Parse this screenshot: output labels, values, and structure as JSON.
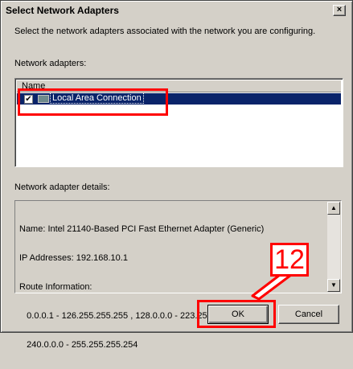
{
  "window": {
    "title": "Select Network Adapters",
    "close_glyph": "×"
  },
  "description": "Select the network adapters associated with the network you are configuring.",
  "adapters": {
    "label": "Network adapters:",
    "column_header": "Name",
    "items": [
      {
        "checked": true,
        "label": "Local Area Connection",
        "icon": "network-adapter-icon"
      }
    ]
  },
  "details": {
    "label": "Network adapter details:",
    "lines": [
      "Name: Intel 21140-Based PCI Fast Ethernet Adapter (Generic)",
      "IP Addresses: 192.168.10.1",
      "Route Information:",
      "   0.0.0.1 - 126.255.255.255 , 128.0.0.0 - 223.255.255.255",
      "   240.0.0.0 - 255.255.255.254"
    ]
  },
  "buttons": {
    "ok": "OK",
    "cancel": "Cancel"
  },
  "annotation": {
    "step": "12",
    "color": "#ff0000"
  },
  "colors": {
    "dialog_bg": "#d4d0c8",
    "selection_bg": "#0a246a"
  }
}
